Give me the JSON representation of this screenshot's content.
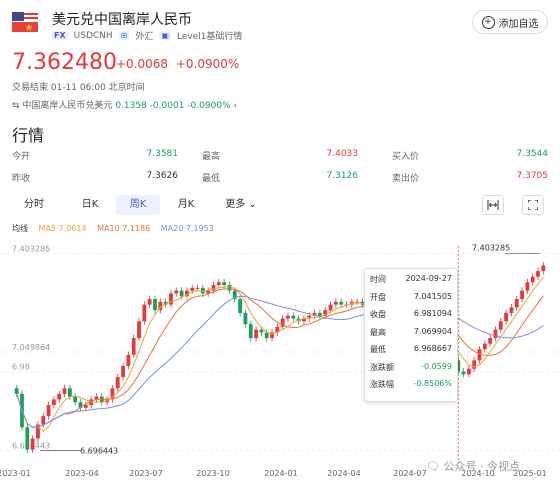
{
  "header": {
    "title": "美元兑中国离岸人民币",
    "fx_tag": "FX",
    "symbol": "USDCNH",
    "market_tag": "外汇",
    "level_tag": "Level1基础行情",
    "add_button_label": "添加自选"
  },
  "quote": {
    "price": "7.362480",
    "change": "+0.0068",
    "change_pct": "+0.0900%",
    "status": "交易结束 01-11 06:00 北京时间",
    "related_label": "中国离岸人民币兑美元",
    "related_price": "0.1358",
    "related_change": "-0.0001",
    "related_change_pct": "-0.0900%"
  },
  "section_title": "行情",
  "stats": [
    {
      "label1": "今开",
      "value1": "7.3581",
      "label2": "最高",
      "value2": "7.4033",
      "label3": "买入价",
      "value3": "7.3544"
    },
    {
      "label1": "昨收",
      "value1": "7.3626",
      "label2": "最低",
      "value2": "7.3126",
      "label3": "卖出价",
      "value3": "7.3705"
    }
  ],
  "tabs": [
    {
      "label": "分时"
    },
    {
      "label": "日K"
    },
    {
      "label": "周K"
    },
    {
      "label": "月K"
    },
    {
      "label": "更多"
    }
  ],
  "active_tab": "周K",
  "ma_legend": {
    "title": "均线",
    "ma5": "MA5 7.0614",
    "ma10": "MA10 7.1186",
    "ma20": "MA20 7.1953",
    "ma5_color": "#f2a33a",
    "ma10_color": "#e8733c",
    "ma20_color": "#7b8fe0"
  },
  "colors": {
    "up": "#e5393b",
    "down": "#1aa05a",
    "accent": "#4a5bd6"
  },
  "tooltip": {
    "rows": [
      {
        "k": "时间",
        "v": "2024-09-27",
        "c": "#333"
      },
      {
        "k": "开盘",
        "v": "7.041505",
        "c": "#333"
      },
      {
        "k": "收盘",
        "v": "6.981094",
        "c": "#333"
      },
      {
        "k": "最高",
        "v": "7.069904",
        "c": "#333"
      },
      {
        "k": "最低",
        "v": "6.968667",
        "c": "#333"
      },
      {
        "k": "涨跌额",
        "v": "-0.0599",
        "c": "#1aa05a"
      },
      {
        "k": "涨跌幅",
        "v": "-0.8506%",
        "c": "#1aa05a"
      }
    ]
  },
  "watermark": "公众号 · 今视点",
  "chart_data": {
    "type": "candlestick",
    "y_ticks": [
      "7.403285",
      "7.049864",
      "6.98",
      "6.696443"
    ],
    "y_tick_values": [
      7.403285,
      7.049864,
      6.98,
      6.696443
    ],
    "x_ticks": [
      "2023-01",
      "2023-04",
      "2023-07",
      "2023-10",
      "2024-01",
      "2024-04",
      "2024-07",
      "2024-10",
      "2025-01"
    ],
    "max_label": "7.403285",
    "min_label": "6.696443",
    "ylim": [
      6.67,
      7.43
    ],
    "closes": [
      6.9,
      6.78,
      6.7,
      6.74,
      6.79,
      6.82,
      6.86,
      6.88,
      6.9,
      6.92,
      6.89,
      6.87,
      6.85,
      6.86,
      6.88,
      6.89,
      6.87,
      6.88,
      6.92,
      6.96,
      7.0,
      7.04,
      7.1,
      7.16,
      7.22,
      7.24,
      7.2,
      7.23,
      7.22,
      7.26,
      7.27,
      7.25,
      7.27,
      7.28,
      7.28,
      7.26,
      7.27,
      7.29,
      7.3,
      7.29,
      7.27,
      7.24,
      7.19,
      7.15,
      7.1,
      7.13,
      7.12,
      7.1,
      7.12,
      7.14,
      7.17,
      7.18,
      7.17,
      7.16,
      7.17,
      7.18,
      7.19,
      7.18,
      7.2,
      7.22,
      7.23,
      7.22,
      7.22,
      7.23,
      7.23,
      7.22,
      7.23,
      7.24,
      7.23,
      7.24,
      7.25,
      7.24,
      7.24,
      7.22,
      7.2,
      7.19,
      7.17,
      7.15,
      7.13,
      7.1,
      7.1,
      7.06,
      7.02,
      6.98,
      6.97,
      6.99,
      7.02,
      7.06,
      7.08,
      7.1,
      7.13,
      7.16,
      7.19,
      7.21,
      7.24,
      7.27,
      7.3,
      7.32,
      7.34,
      7.36
    ]
  }
}
